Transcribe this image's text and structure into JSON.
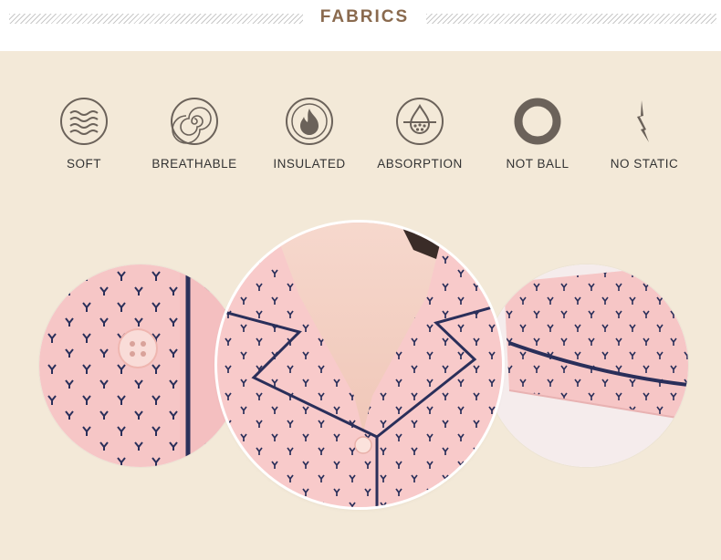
{
  "header": {
    "title": "FABRICS"
  },
  "features": [
    {
      "icon": "waves-icon",
      "label": "SOFT"
    },
    {
      "icon": "spiral-icon",
      "label": "BREATHABLE"
    },
    {
      "icon": "flame-icon",
      "label": "INSULATED"
    },
    {
      "icon": "droplet-icon",
      "label": "ABSORPTION"
    },
    {
      "icon": "ring-icon",
      "label": "NOT BALL"
    },
    {
      "icon": "lightning-icon",
      "label": "NO STATIC"
    }
  ],
  "photos": [
    {
      "name": "button-detail-photo"
    },
    {
      "name": "collar-detail-photo"
    },
    {
      "name": "sleeve-detail-photo"
    }
  ],
  "colors": {
    "accent": "#8a6a4e",
    "icon": "#6b625a",
    "background": "#f3e9d8",
    "fabric": "#f6c9c9",
    "piping": "#2a2f5a"
  }
}
